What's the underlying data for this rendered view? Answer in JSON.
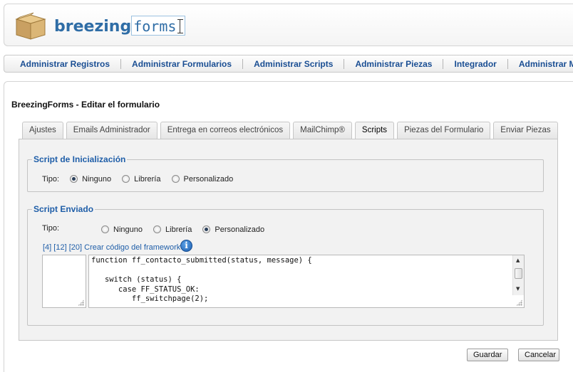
{
  "header": {
    "logo_bold": "breezing",
    "logo_light": "forms"
  },
  "nav": {
    "items": [
      "Administrar Registros",
      "Administrar Formularios",
      "Administrar Scripts",
      "Administrar Piezas",
      "Integrador",
      "Administrar Menús"
    ]
  },
  "page": {
    "title": "BreezingForms - Editar el formulario"
  },
  "tabs": [
    "Ajustes",
    "Emails Administrador",
    "Entrega en correos electrónicos",
    "MailChimp®",
    "Scripts",
    "Piezas del Formulario",
    "Enviar Piezas"
  ],
  "active_tab": "Scripts",
  "init_script": {
    "legend": "Script de Inicialización",
    "tipo_label": "Tipo:",
    "options": [
      "Ninguno",
      "Librería",
      "Personalizado"
    ],
    "selected": "Ninguno"
  },
  "submit_script": {
    "legend": "Script Enviado",
    "tipo_label": "Tipo:",
    "options": [
      "Ninguno",
      "Librería",
      "Personalizado"
    ],
    "selected": "Personalizado",
    "links": {
      "l4": "[4]",
      "l12": "[12]",
      "l20": "[20]",
      "framework": "Crear código del framework"
    },
    "code": "function ff_contacto_submitted(status, message) {\n\n   switch (status) {\n      case FF_STATUS_OK:\n         ff_switchpage(2);"
  },
  "buttons": {
    "save": "Guardar",
    "cancel": "Cancelar"
  }
}
